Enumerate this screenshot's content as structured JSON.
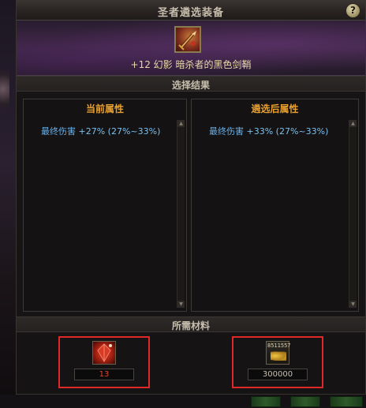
{
  "dialog": {
    "title": "圣者遴选装备",
    "help_label": "?"
  },
  "item": {
    "icon": "sword-sheath-icon",
    "name": "+12 幻影  暗杀者的黑色剑鞘"
  },
  "result_section": {
    "label": "选择结果",
    "current": {
      "header": "当前属性",
      "stat_name": "最终伤害",
      "stat_value": "+27% (27%~33%)"
    },
    "after": {
      "header": "遴选后属性",
      "stat_name": "最终伤害",
      "stat_value": "+33% (27%~33%)"
    }
  },
  "materials_section": {
    "label": "所需材料",
    "items": [
      {
        "icon": "red-crystal-icon",
        "count": "13",
        "count_color": "#e84030"
      },
      {
        "icon": "gold-coins-icon",
        "icon_text": "8511557",
        "count": "300000",
        "count_color": "#c8c0b0"
      }
    ]
  },
  "colors": {
    "header_accent": "#e8a030",
    "stat_text": "#6ab0e8",
    "highlight_border": "#e02828"
  }
}
